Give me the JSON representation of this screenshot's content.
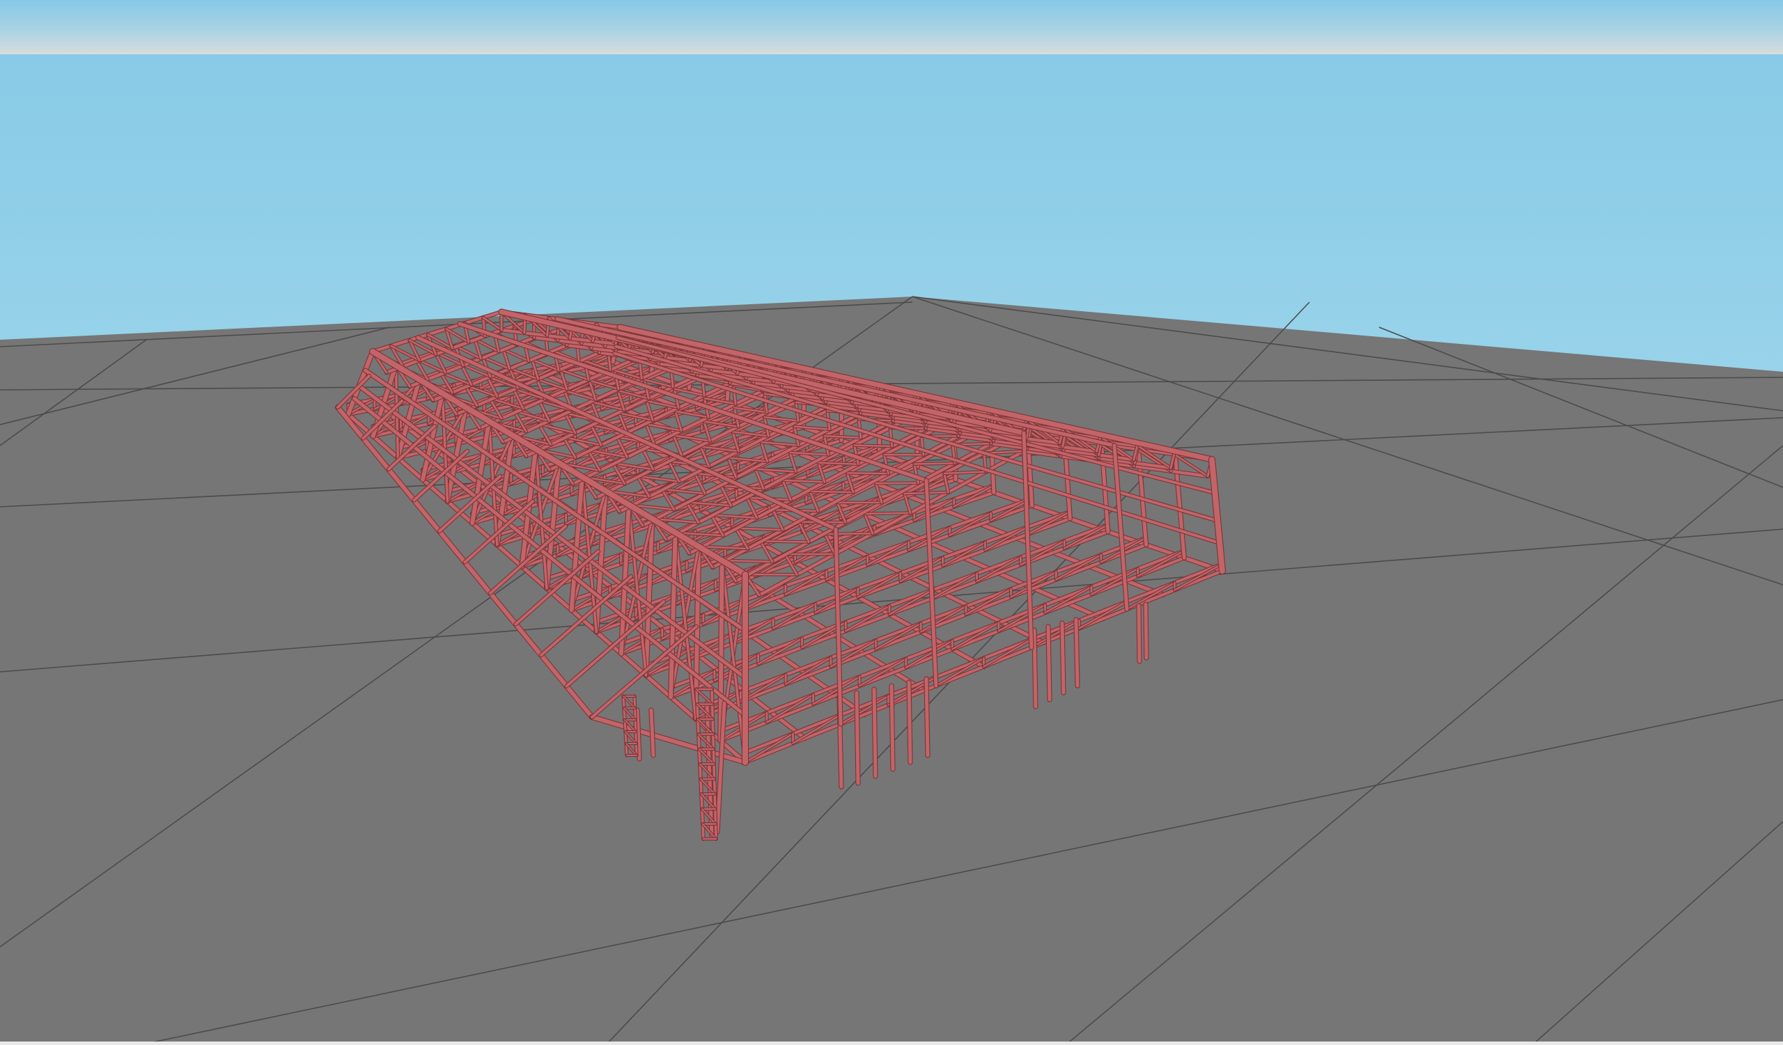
{
  "app": {
    "title": ""
  },
  "viewport": {
    "sky_top": "#86c9e6",
    "sky_bottom": "#96d2ea",
    "ground_color": "#767676",
    "grid_color": "#4b4b4b",
    "structure_color": "#c26468",
    "structure_dark": "#7a3538",
    "grid_visible": true
  },
  "model": {
    "type": "steel truss frame",
    "icon": "truss-structure-icon"
  }
}
